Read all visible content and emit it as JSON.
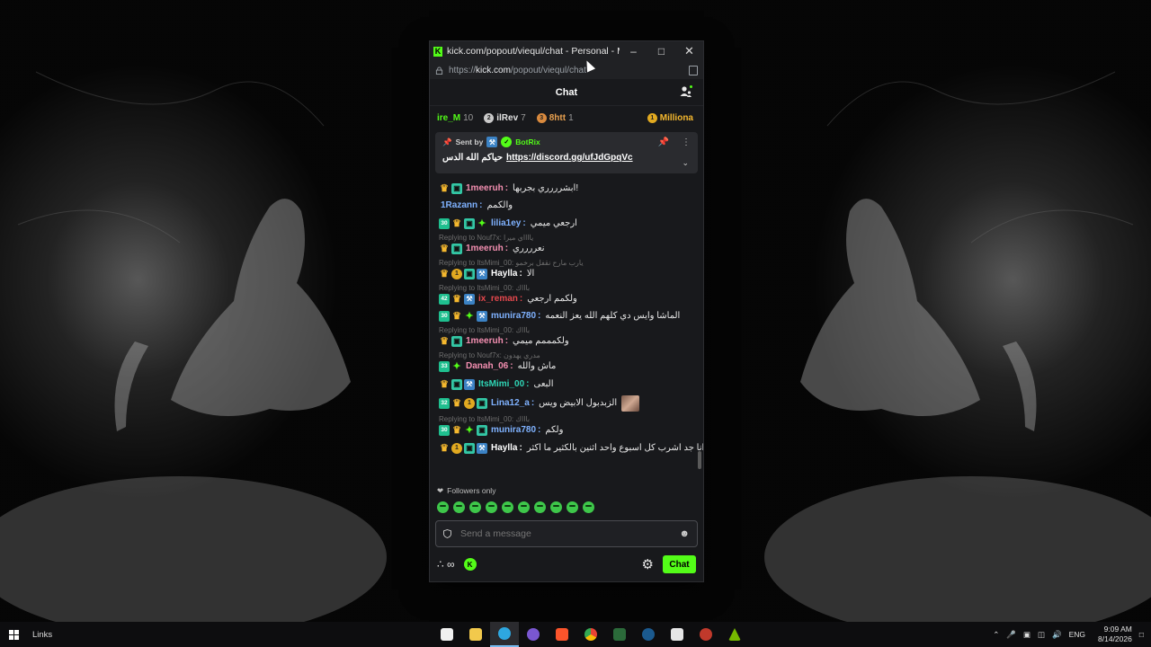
{
  "window": {
    "title": "kick.com/popout/viequl/chat - Personal - Micr...",
    "url_prefix": "https://",
    "url_host": "kick.com",
    "url_path": "/popout/viequl/chat"
  },
  "chat": {
    "title": "Chat",
    "leaderboard": [
      {
        "name": "ire_M",
        "count": "10",
        "color": "#53fc18",
        "rank_color": "#53fc18",
        "rank": ""
      },
      {
        "name": "ilRev",
        "count": "7",
        "color": "#e0e0e0",
        "rank_color": "#c9c9c9",
        "rank": "2"
      },
      {
        "name": "8htt",
        "count": "1",
        "color": "#e8a04f",
        "rank_color": "#d98a3e",
        "rank": "3"
      },
      {
        "name": "Milliona",
        "count": "",
        "color": "#f5b82e",
        "rank_color": "#e1a920",
        "rank": "1"
      }
    ],
    "pinned": {
      "sent_by_label": "Sent by",
      "bot_name": "BotRix",
      "text": "حياكم الله الدس",
      "link": "https://discord.gg/ufJdGpqVc"
    },
    "messages": [
      {
        "badges": [
          "crown",
          "og"
        ],
        "user": "1meeruh",
        "user_color": "#f48fb1",
        "text": "ابشرررري بجربها!"
      },
      {
        "badges": [],
        "user": "1Razann",
        "user_color": "#7fb2ff",
        "text": "والكمم"
      },
      {
        "badges": [
          "num:30",
          "crown",
          "og",
          "gift"
        ],
        "user": "lilia1ey",
        "user_color": "#7fb2ff",
        "text": "ارجعي ميمي"
      },
      {
        "reply": "Replying to Nouf7x: يااااي ميرا",
        "badges": [
          "crown",
          "og"
        ],
        "user": "1meeruh",
        "user_color": "#f48fb1",
        "text": "نعرررري"
      },
      {
        "reply": "Replying to ItsMimi_00: يارب مارح نقفل برخمو",
        "badges": [
          "crown",
          "one",
          "og",
          "mod"
        ],
        "user": "Haylla",
        "user_color": "#ffffff",
        "text": "الا"
      },
      {
        "reply": "Replying to ItsMimi_00: باااك",
        "badges": [
          "num:42",
          "crown",
          "mod"
        ],
        "user": "ix_reman",
        "user_color": "#e5484d",
        "text": "ولكمم ارجعي"
      },
      {
        "badges": [
          "num:30",
          "crown",
          "gift",
          "mod"
        ],
        "user": "munira780",
        "user_color": "#7fb2ff",
        "text": "الماشا وايس دي كلهم الله يعز النعمه"
      },
      {
        "reply": "Replying to ItsMimi_00: باااك",
        "badges": [
          "crown",
          "og"
        ],
        "user": "1meeruh",
        "user_color": "#f48fb1",
        "text": "ولكمممم ميمي"
      },
      {
        "reply": "Replying to Nouf7x: مدري يهدون",
        "badges": [
          "num:33",
          "gift"
        ],
        "user": "Danah_06",
        "user_color": "#f48fb1",
        "text": "ماش والله"
      },
      {
        "badges": [
          "crown",
          "og",
          "mod"
        ],
        "user": "ItsMimi_00",
        "user_color": "#2fd6b6",
        "text": "البعى"
      },
      {
        "badges": [
          "num:32",
          "crown",
          "one",
          "og"
        ],
        "user": "Lina12_a",
        "user_color": "#7fb2ff",
        "text": "الزبدبول الابيض ويس",
        "image": true
      },
      {
        "reply": "Replying to ItsMimi_00: باااك",
        "badges": [
          "num:30",
          "crown",
          "gift",
          "og"
        ],
        "user": "munira780",
        "user_color": "#7fb2ff",
        "text": "ولكم"
      },
      {
        "badges": [
          "crown",
          "one",
          "og",
          "mod"
        ],
        "user": "Haylla",
        "user_color": "#ffffff",
        "text": "شوف انا جد اشرب كل اسبوع واحد اثنين بالكثير ما اكثر"
      }
    ],
    "followers_only": "Followers only",
    "input_placeholder": "Send a message",
    "chat_button": "Chat"
  },
  "taskbar": {
    "links_label": "Links",
    "lang": "ENG",
    "time": "9:09 AM",
    "date": "8/14/2026"
  },
  "colors": {
    "kick_green": "#53fc18",
    "panel_bg": "#18191c",
    "pinned_bg": "#2a2b2f"
  }
}
